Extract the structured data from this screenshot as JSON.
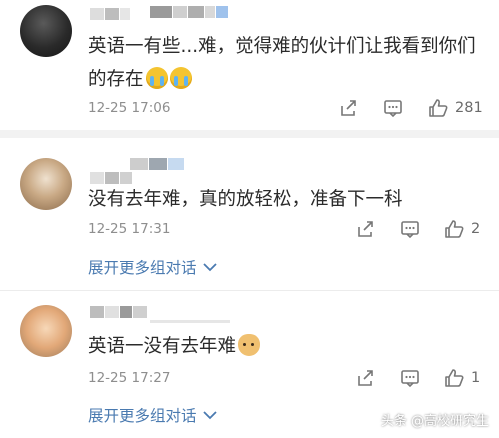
{
  "comments": [
    {
      "text": "英语一有些...难，觉得难的伙计们让我看到你们的存在",
      "emojis": [
        "crying-emoji",
        "crying-emoji"
      ],
      "timestamp": "12-25 17:06",
      "likes": "281"
    },
    {
      "text": "没有去年难，真的放轻松，准备下一科",
      "timestamp": "12-25 17:31",
      "likes": "2",
      "expand_label": "展开更多组对话"
    },
    {
      "text": "英语一没有去年难",
      "emojis": [
        "doge-emoji"
      ],
      "timestamp": "12-25 17:27",
      "likes": "1",
      "expand_label": "展开更多组对话"
    }
  ],
  "watermark": "头条 @高校研究生",
  "colors": {
    "link": "#4a7ab0",
    "text": "#2b2b2b",
    "meta": "#8e8e8e",
    "divider": "#f2f2f2"
  },
  "icons": [
    "share-icon",
    "reply-icon",
    "like-icon",
    "chevron-down-icon"
  ]
}
